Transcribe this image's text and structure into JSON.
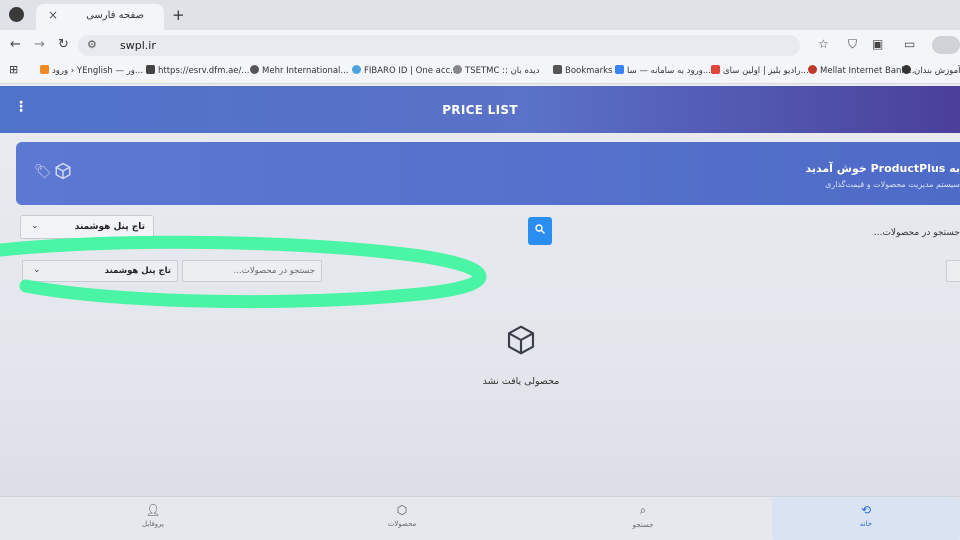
{
  "browser": {
    "tab_title": "صفحه فارسی",
    "tab_close": "×",
    "new_tab": "+",
    "url": "swpl.ir",
    "bookmarks": [
      {
        "label": "ورود › YEnglish — ور...",
        "color": "#f08a24"
      },
      {
        "label": "https://esrv.dfm.ae/...",
        "color": "#444444"
      },
      {
        "label": "Mehr International...",
        "color": "#555555"
      },
      {
        "label": "FIBARO ID | One acc...",
        "color": "#4aa3df"
      },
      {
        "label": "TSETMC :: دیده بان",
        "color": "#888888"
      },
      {
        "label": "Bookmarks",
        "color": "#555555"
      },
      {
        "label": "ورود به سامانه — سا...",
        "color": "#3b82f6"
      },
      {
        "label": "رادیو بلیز | اولین سای...",
        "color": "#e0463a"
      },
      {
        "label": "Mellat Internet Bank...",
        "color": "#c0392b"
      },
      {
        "label": "آموزش بندان...",
        "color": "#333333"
      }
    ]
  },
  "app": {
    "title": "PRICE LIST",
    "banner": {
      "welcome": "به ProductPlus خوش آمدید",
      "subtitle": "سیستم مدیریت محصولات و قیمت‌گذاری"
    },
    "filter_primary": {
      "label": "تاج پنل هوشمند"
    },
    "search_placeholder": "جستجو در محصولات...",
    "filter_secondary": {
      "label": "تاج پنل هوشمند",
      "placeholder": "جستجو در محصولات..."
    },
    "empty_state": {
      "text": "محصولی یافت نشد"
    },
    "bottom_nav": [
      {
        "key": "profile",
        "label": "پروفایل",
        "icon": "user-icon"
      },
      {
        "key": "products",
        "label": "محصولات",
        "icon": "box-icon"
      },
      {
        "key": "search",
        "label": "جستجو",
        "icon": "search-icon"
      },
      {
        "key": "home",
        "label": "خانه",
        "icon": "home-icon",
        "active": true
      }
    ]
  },
  "colors": {
    "appbar": "#5a72c8",
    "banner": "#5570cd",
    "search_button": "#2a8df0",
    "marker": "#3df59e"
  }
}
